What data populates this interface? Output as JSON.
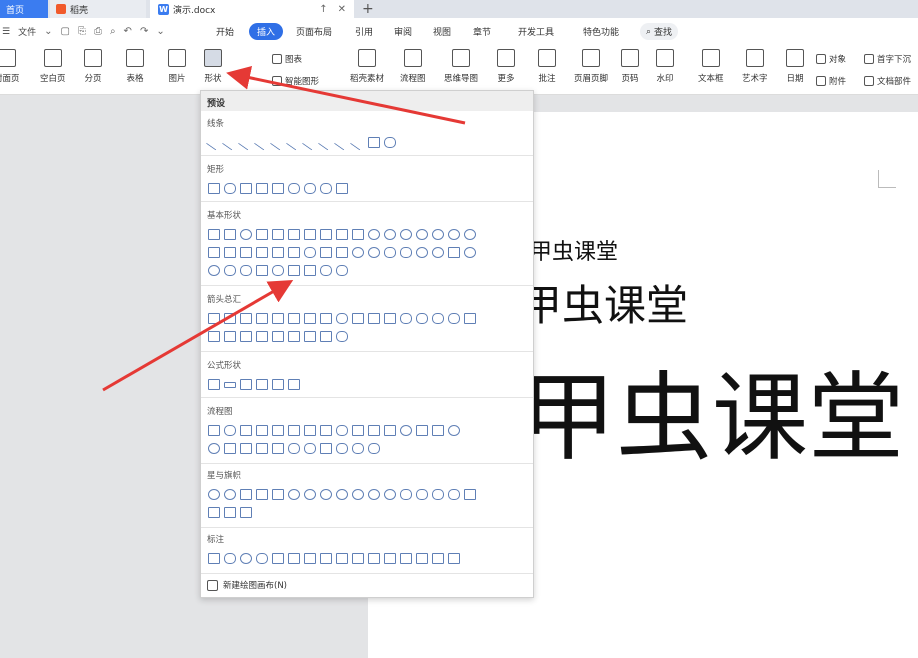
{
  "title_bar": {
    "home_tab": "首页",
    "daoke_tab": "稻壳",
    "doc_tab": "演示.docx",
    "new_tab_symbol": "+"
  },
  "menu": {
    "file_label": "文件",
    "items": [
      "开始",
      "插入",
      "页面布局",
      "引用",
      "审阅",
      "视图",
      "章节",
      "开发工具",
      "特色功能"
    ],
    "active_item": "插入",
    "search_label": "查找"
  },
  "toolbar": {
    "tools": [
      "封面页",
      "空白页",
      "分页",
      "表格",
      "图片",
      "形状",
      "稻壳素材",
      "流程图",
      "思维导图",
      "更多",
      "批注",
      "页眉页脚",
      "页码",
      "水印",
      "文本框",
      "艺术字",
      "日期"
    ],
    "small_tools": {
      "chart": "图表",
      "icon_lib": "智能图形",
      "object": "对象",
      "attachment": "附件",
      "dropcap": "首字下沉",
      "doc_parts": "文档部件"
    }
  },
  "dropdown": {
    "header": "预设",
    "categories": [
      "线条",
      "矩形",
      "基本形状",
      "箭头总汇",
      "公式形状",
      "流程图",
      "星与旗帜",
      "标注"
    ],
    "footer": "新建绘图画布(N)"
  },
  "document": {
    "line1": "甲虫课堂",
    "line2": "甲虫课堂",
    "line3": "甲虫课堂"
  },
  "colors": {
    "accent": "#2f6fe6",
    "shape_stroke": "#5f7fb5",
    "arrow": "#e53935"
  }
}
